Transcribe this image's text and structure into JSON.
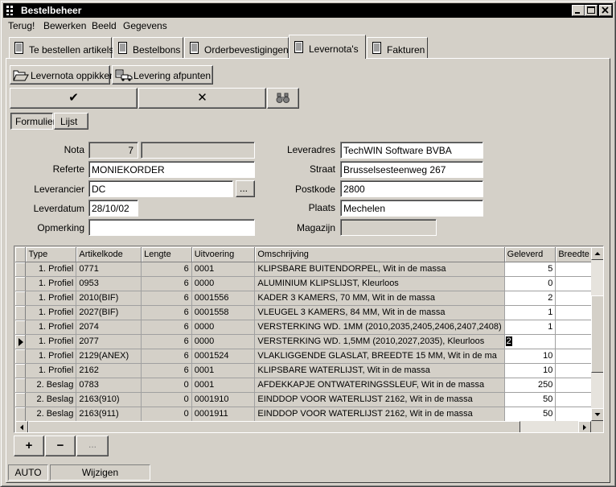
{
  "window": {
    "title": "Bestelbeheer"
  },
  "menu": [
    "Terug!",
    "Bewerken",
    "Beeld",
    "Gegevens"
  ],
  "tabs": [
    {
      "label": "Te bestellen artikels"
    },
    {
      "label": "Bestelbons"
    },
    {
      "label": "Orderbevestigingen"
    },
    {
      "label": "Levernota's"
    },
    {
      "label": "Fakturen"
    }
  ],
  "toolbar": {
    "pick_label": "Levernota oppikken",
    "finish_label": "Levering afpunten",
    "confirm_glyph": "✔",
    "cancel_glyph": "✕"
  },
  "view_toggle": {
    "form_label": "Formulier",
    "list_label": "Lijst"
  },
  "form": {
    "nota_label": "Nota",
    "nota_value": "7",
    "referte_label": "Referte",
    "referte_value": "MONIEKORDER",
    "leverancier_label": "Leverancier",
    "leverancier_value": "DC",
    "browse_label": "...",
    "leverdatum_label": "Leverdatum",
    "leverdatum_value": "28/10/02",
    "opmerking_label": "Opmerking",
    "opmerking_value": "",
    "leveradres_label": "Leveradres",
    "leveradres_value": "TechWIN Software BVBA",
    "straat_label": "Straat",
    "straat_value": "Brusselsesteenweg 267",
    "postkode_label": "Postkode",
    "postkode_value": "2800",
    "plaats_label": "Plaats",
    "plaats_value": "Mechelen",
    "magazijn_label": "Magazijn",
    "magazijn_value": ""
  },
  "grid": {
    "columns": [
      "Type",
      "Artikelkode",
      "Lengte",
      "Uitvoering",
      "Omschrijving",
      "Geleverd",
      "Breedte"
    ],
    "rows": [
      [
        "1. Profiel",
        "0771",
        "6",
        "0001",
        "KLIPSBARE BUITENDORPEL,   Wit in de massa",
        "5",
        ""
      ],
      [
        "1. Profiel",
        "0953",
        "6",
        "0000",
        "ALUMINIUM KLIPSLIJST,   Kleurloos",
        "0",
        ""
      ],
      [
        "1. Profiel",
        "2010(BIF)",
        "6",
        "0001556",
        "KADER 3 KAMERS, 70 MM,   Wit in de massa",
        "2",
        ""
      ],
      [
        "1. Profiel",
        "2027(BIF)",
        "6",
        "0001558",
        "VLEUGEL 3 KAMERS, 84 MM,   Wit in de massa",
        "1",
        ""
      ],
      [
        "1. Profiel",
        "2074",
        "6",
        "0000",
        "VERSTERKING WD. 1MM (2010,2035,2405,2406,2407,2408)",
        "1",
        ""
      ],
      [
        "1. Profiel",
        "2077",
        "6",
        "0000",
        "VERSTERKING WD. 1,5MM (2010,2027,2035),   Kleurloos",
        "2",
        ""
      ],
      [
        "1. Profiel",
        "2129(ANEX)",
        "6",
        "0001524",
        "VLAKLIGGENDE GLASLAT, BREEDTE 15 MM,   Wit in de ma",
        "10",
        ""
      ],
      [
        "1. Profiel",
        "2162",
        "6",
        "0001",
        "KLIPSBARE WATERLIJST,   Wit in de massa",
        "10",
        ""
      ],
      [
        "2. Beslag",
        "0783",
        "0",
        "0001",
        "AFDEKKAPJE ONTWATERINGSSLEUF,   Wit in de massa",
        "250",
        ""
      ],
      [
        "2. Beslag",
        "2163(910)",
        "0",
        "0001910",
        "EINDDOP VOOR WATERLIJST 2162,   Wit in de massa",
        "50",
        ""
      ],
      [
        "2. Beslag",
        "2163(911)",
        "0",
        "0001911",
        "EINDDOP VOOR WATERLIJST 2162,   Wit in de massa",
        "50",
        ""
      ]
    ],
    "current_row": 5
  },
  "bottom_buttons": {
    "add": "+",
    "remove": "−",
    "more": "..."
  },
  "status": {
    "mode": "AUTO",
    "action": "Wijzigen"
  },
  "colors": {
    "titlebar": "#000000",
    "face": "#d4d0c8",
    "field": "#ffffff"
  }
}
